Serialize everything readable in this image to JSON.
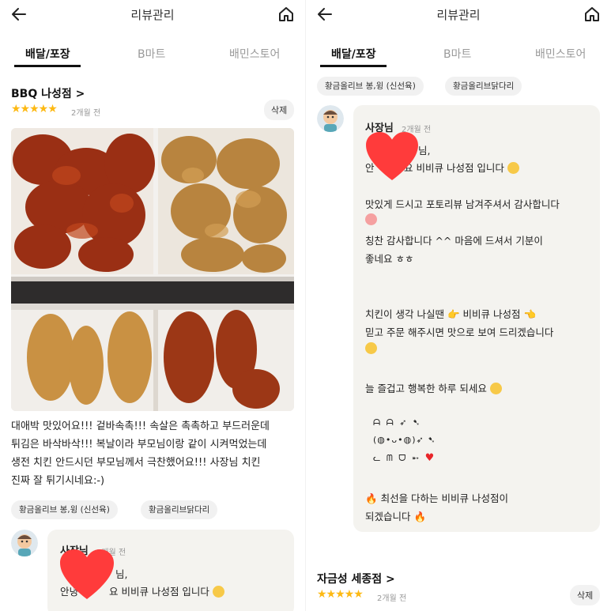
{
  "left": {
    "header": {
      "title": "리뷰관리"
    },
    "tabs": [
      "배달/포장",
      "B마트",
      "배민스토어"
    ],
    "store": {
      "name": "BBQ 나성점 >",
      "stars": "★★★★★",
      "date": "2개월 전",
      "delete_label": "삭제"
    },
    "review_lines": [
      "대애박 맛있어요!!! 겉바속촉!!! 속살은 촉촉하고 부드러운데",
      "튀김은 바삭바삭!!! 복날이라 부모님이랑 같이 시켜먹었는데",
      "생전 치킨 안드시던 부모님께서 극찬했어요!!! 사장님 치킨",
      "진짜 잘 튀기시네요:-)"
    ],
    "chips": [
      "황금올리브 봉,윙 (신선육)",
      "황금올리브닭다리"
    ],
    "reply": {
      "owner": "사장님",
      "date": "2개월 전",
      "line1": "님,",
      "line2_a": "안녕",
      "line2_b": "요 비비큐 나성점 입니다"
    }
  },
  "right": {
    "header": {
      "title": "리뷰관리"
    },
    "tabs": [
      "배달/포장",
      "B마트",
      "배민스토어"
    ],
    "chips": [
      "황금올리브 봉,윙 (신선육)",
      "황금올리브닭다리"
    ],
    "reply": {
      "owner": "사장님",
      "date": "2개월 전",
      "line1": "님,",
      "line2_a": "안",
      "line2_b": "요 비비큐 나성점 입니다",
      "p2_1": "맛있게 드시고 포토리뷰 남겨주셔서 감사합니다",
      "p2_2": "칭찬 감사합니다 ^^ 마음에 드셔서 기분이",
      "p2_3": "좋네요 ㅎㅎ",
      "p3_1a": "치킨이 생각 나실땐",
      "p3_1b": "비비큐 나성점",
      "p3_2": "믿고 주문 해주시면 맛으로 보여 드리겠습니다",
      "p4": "늘 즐겁고 행복한 하루 되세요",
      "art1": "ᗩ     ᗩ    ➶   ➷",
      "art2": "(◍•ᴗ•◍)➶        ➷",
      "art3": "ᓚ   ᗰ   ᗜ             ➵",
      "p5_1": "최선을 다하는 비비큐 나성점이",
      "p5_2": "되겠습니다"
    },
    "next_store": {
      "name": "자금성 세종점 >",
      "stars": "★★★★★",
      "date": "2개월 전",
      "delete_label": "삭제"
    }
  },
  "colors": {
    "accent_tab": "#111111",
    "star": "#fdb913",
    "reply_bg": "#f4f3ef",
    "heart": "#ff3b3b"
  }
}
